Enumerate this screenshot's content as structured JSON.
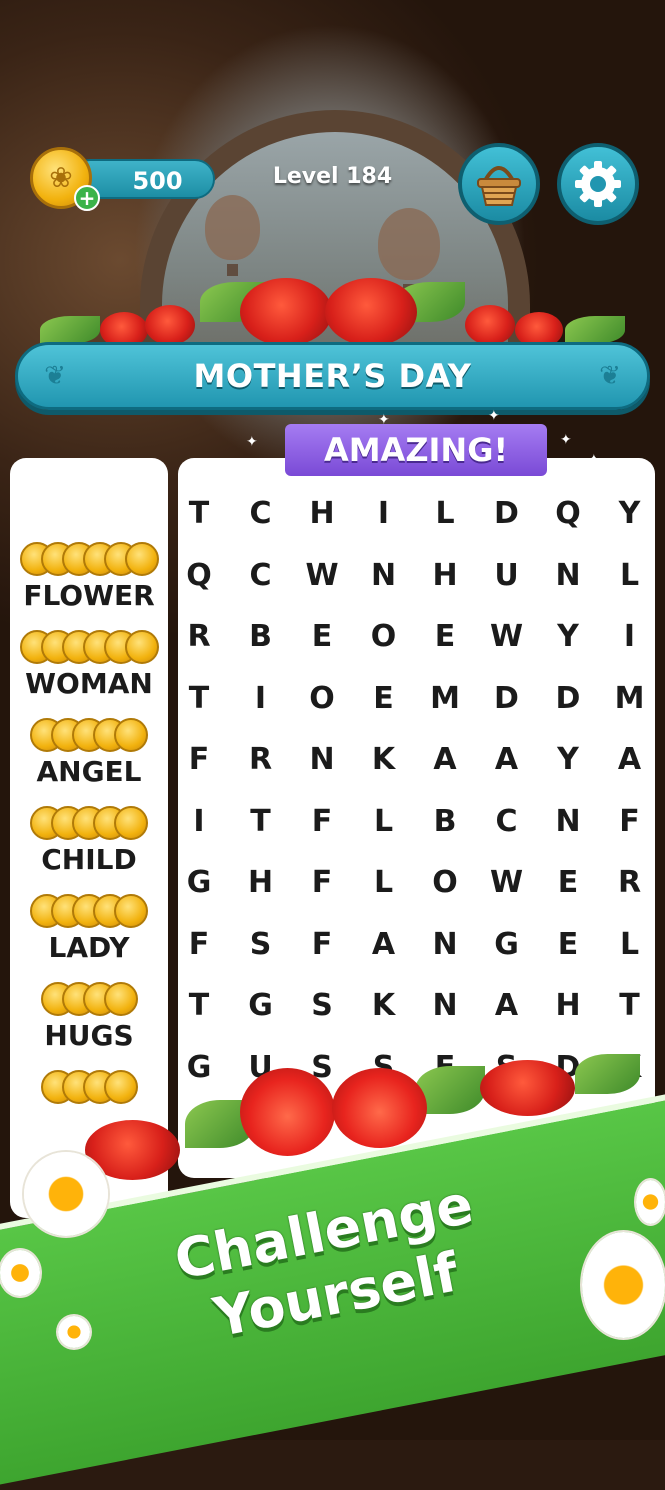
{
  "header": {
    "coins": "500",
    "level": "Level 184"
  },
  "banner": {
    "title": "MOTHER’S DAY"
  },
  "praise": {
    "text": "AMAZING!"
  },
  "words": [
    {
      "label": "FLOWER",
      "coins": 6
    },
    {
      "label": "WOMAN",
      "coins": 6
    },
    {
      "label": "ANGEL",
      "coins": 5
    },
    {
      "label": "CHILD",
      "coins": 5
    },
    {
      "label": "LADY",
      "coins": 5
    },
    {
      "label": "HUGS",
      "coins": 4
    },
    {
      "label": "",
      "coins": 4
    }
  ],
  "grid": [
    [
      "T",
      "C",
      "H",
      "I",
      "L",
      "D",
      "Q",
      "Y"
    ],
    [
      "Q",
      "C",
      "W",
      "N",
      "H",
      "U",
      "N",
      "L"
    ],
    [
      "R",
      "B",
      "E",
      "O",
      "E",
      "W",
      "Y",
      "I"
    ],
    [
      "T",
      "I",
      "O",
      "E",
      "M",
      "D",
      "D",
      "M"
    ],
    [
      "F",
      "R",
      "N",
      "K",
      "A",
      "A",
      "Y",
      "A"
    ],
    [
      "I",
      "T",
      "F",
      "L",
      "B",
      "C",
      "N",
      "F"
    ],
    [
      "G",
      "H",
      "F",
      "L",
      "O",
      "W",
      "E",
      "R"
    ],
    [
      "F",
      "S",
      "F",
      "A",
      "N",
      "G",
      "E",
      "L"
    ],
    [
      "T",
      "G",
      "S",
      "K",
      "N",
      "A",
      "H",
      "T"
    ],
    [
      "G",
      "U",
      "S",
      "S",
      "E",
      "S",
      "D",
      "K"
    ]
  ],
  "promo": {
    "line1": "Challenge",
    "line2": "Yourself"
  },
  "colors": {
    "teal": "#2196b0",
    "purple": "#7a4ad6",
    "green": "#3ea52f",
    "gold": "#f2b20e"
  }
}
